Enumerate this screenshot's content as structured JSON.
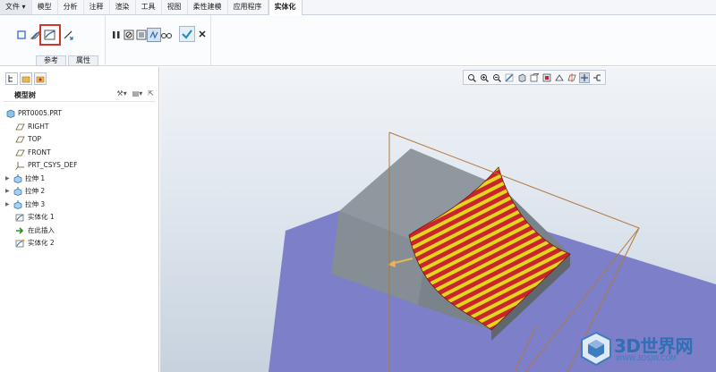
{
  "menu": {
    "tabs": [
      "文件 ▾",
      "模型",
      "分析",
      "注释",
      "渲染",
      "工具",
      "视图",
      "柔性建模",
      "应用程序",
      "实体化"
    ]
  },
  "ribbon": {
    "subtabs": [
      "参考",
      "属性"
    ],
    "selected_tool": "implicit-surface-icon"
  },
  "tree": {
    "title": "模型树",
    "nodes": [
      {
        "label": "PRT0005.PRT",
        "icon": "part-icon",
        "expandable": false
      },
      {
        "label": "RIGHT",
        "icon": "datum-plane-icon",
        "expandable": false
      },
      {
        "label": "TOP",
        "icon": "datum-plane-icon",
        "expandable": false
      },
      {
        "label": "FRONT",
        "icon": "datum-plane-icon",
        "expandable": false
      },
      {
        "label": "PRT_CSYS_DEF",
        "icon": "csys-icon",
        "expandable": false
      },
      {
        "label": "拉伸 1",
        "icon": "extrude-icon",
        "expandable": true
      },
      {
        "label": "拉伸 2",
        "icon": "extrude-icon",
        "expandable": true
      },
      {
        "label": "拉伸 3",
        "icon": "extrude-icon",
        "expandable": true
      },
      {
        "label": "实体化 1",
        "icon": "solidify-icon",
        "expandable": false
      },
      {
        "label": "在此插入",
        "icon": "insert-arrow-icon",
        "expandable": false
      },
      {
        "label": "实体化 2",
        "icon": "solidify-new-icon",
        "expandable": false
      }
    ]
  },
  "watermark": {
    "brand": "3D世界网",
    "url": "WWW.3DSJW.COM"
  },
  "colors": {
    "stripe_red": "#c8262a",
    "stripe_yellow": "#e4d61e",
    "plane_blue": "#7d80c8",
    "block_gray": "#8f979f",
    "highlight_red": "#d7322b"
  }
}
